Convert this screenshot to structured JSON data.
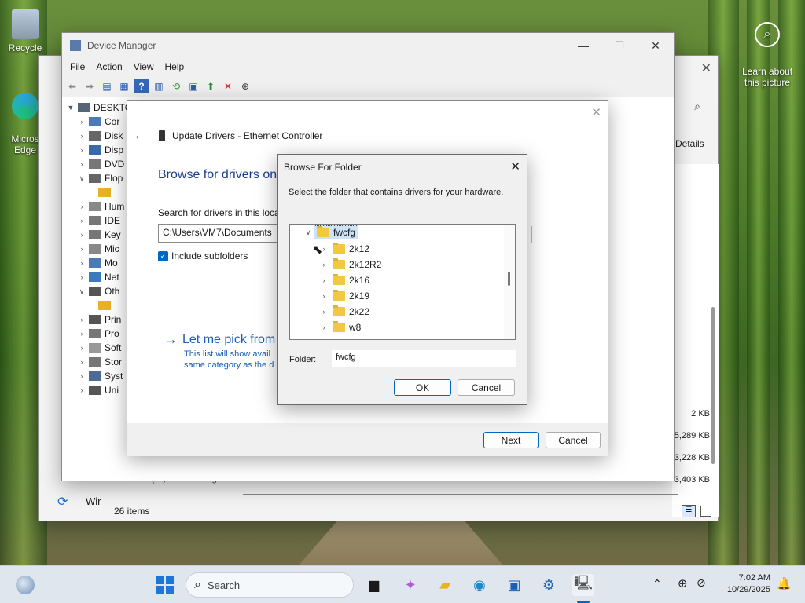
{
  "desktop": {
    "icons": [
      {
        "label": "Recycle"
      },
      {
        "label": "Micros\nEdge"
      }
    ],
    "learn_about": "Learn about\nthis picture"
  },
  "device_manager": {
    "title": "Device Manager",
    "menu": [
      "File",
      "Action",
      "View",
      "Help"
    ],
    "tree_root": "DESKTO",
    "tree_items": [
      "Cor",
      "Disk",
      "Disp",
      "DVD",
      "Flop",
      "",
      "Hum",
      "IDE",
      "Key",
      "Mic",
      "Mo",
      "Net",
      "Oth",
      "",
      "Prin",
      "Pro",
      "Soft",
      "Stor",
      "Syst",
      "Uni"
    ]
  },
  "explorer_bg": {
    "details": "Details",
    "sizes": [
      "2 KB",
      "5,289 KB",
      "3,228 KB",
      "3,403 KB"
    ],
    "status": "26 items",
    "bottom_row": "CD Drive (D:) VI   vmware-guest-tools",
    "win_label": "Wir"
  },
  "update_drivers": {
    "title": "Update Drivers - Ethernet Controller",
    "heading": "Browse for drivers on",
    "search_label": "Search for drivers in this locat",
    "path_value": "C:\\Users\\VM7\\Documents",
    "include_subfolders": "Include subfolders",
    "let_me_pick": "Let me pick from",
    "desc_line1": "This list will show avail",
    "desc_line2": "same category as the d",
    "next": "Next",
    "cancel": "Cancel"
  },
  "browse_folder": {
    "title": "Browse For Folder",
    "instruction": "Select the folder that contains drivers for your hardware.",
    "root": "fwcfg",
    "children": [
      "2k12",
      "2k12R2",
      "2k16",
      "2k19",
      "2k22",
      "w8"
    ],
    "folder_label": "Folder:",
    "folder_value": "fwcfg",
    "ok": "OK",
    "cancel": "Cancel"
  },
  "taskbar": {
    "search_placeholder": "Search",
    "time": "7:02 AM",
    "date": "10/29/2025"
  }
}
